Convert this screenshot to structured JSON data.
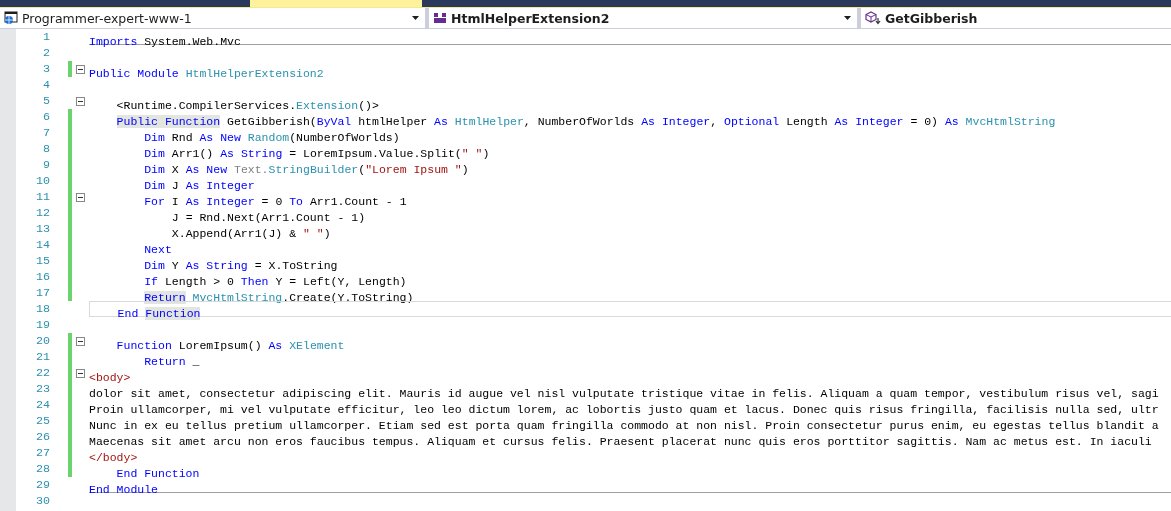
{
  "navigation_bar": [
    {
      "kind": "project",
      "label": "Programmer-expert-www-1"
    },
    {
      "kind": "class",
      "label": "HtmlHelperExtension2"
    },
    {
      "kind": "member",
      "label": "GetGibberish"
    }
  ],
  "editor": {
    "lines": [
      {
        "number": "1",
        "changed": false,
        "fold": false,
        "current": false,
        "separator_below": true,
        "tokens": [
          {
            "kind": "kw",
            "text": "Imports"
          },
          {
            "kind": "plain",
            "text": " System.Web.Mvc"
          }
        ]
      },
      {
        "number": "2",
        "changed": false,
        "fold": false,
        "current": false,
        "separator_below": false
      },
      {
        "number": "3",
        "changed": true,
        "fold": true,
        "current": false,
        "separator_below": false,
        "tokens": [
          {
            "kind": "kw",
            "text": "Public Module "
          },
          {
            "kind": "type",
            "text": "HtmlHelperExtension2"
          }
        ]
      },
      {
        "number": "4",
        "changed": false,
        "fold": false,
        "current": false,
        "separator_below": false
      },
      {
        "number": "5",
        "changed": false,
        "fold": true,
        "current": false,
        "separator_below": false,
        "tokens": [
          {
            "kind": "plain",
            "text": "    <Runtime.CompilerServices."
          },
          {
            "kind": "type",
            "text": "Extension"
          },
          {
            "kind": "plain",
            "text": "()>"
          }
        ]
      },
      {
        "number": "6",
        "changed": true,
        "fold": false,
        "current": false,
        "separator_below": false,
        "tokens": [
          {
            "kind": "ref",
            "text": "    Public Function"
          },
          {
            "kind": "plain",
            "text": " GetGibberish("
          },
          {
            "kind": "kw",
            "text": "ByVal"
          },
          {
            "kind": "plain",
            "text": " htmlHelper "
          },
          {
            "kind": "kw",
            "text": "As "
          },
          {
            "kind": "type",
            "text": "HtmlHelper"
          },
          {
            "kind": "plain",
            "text": ", NumberOfWorlds "
          },
          {
            "kind": "kw",
            "text": "As Integer"
          },
          {
            "kind": "plain",
            "text": ", "
          },
          {
            "kind": "kw",
            "text": "Optional"
          },
          {
            "kind": "plain",
            "text": " Length "
          },
          {
            "kind": "kw",
            "text": "As Integer"
          },
          {
            "kind": "plain",
            "text": " = 0) "
          },
          {
            "kind": "kw",
            "text": "As "
          },
          {
            "kind": "type",
            "text": "MvcHtmlString"
          }
        ]
      },
      {
        "number": "7",
        "changed": true,
        "fold": false,
        "current": false,
        "separator_below": false,
        "tokens": [
          {
            "kind": "kw",
            "text": "        Dim"
          },
          {
            "kind": "plain",
            "text": " Rnd "
          },
          {
            "kind": "kw",
            "text": "As New "
          },
          {
            "kind": "type",
            "text": "Random"
          },
          {
            "kind": "plain",
            "text": "(NumberOfWorlds)"
          }
        ]
      },
      {
        "number": "8",
        "changed": true,
        "fold": false,
        "current": false,
        "separator_below": false,
        "tokens": [
          {
            "kind": "kw",
            "text": "        Dim"
          },
          {
            "kind": "plain",
            "text": " Arr1() "
          },
          {
            "kind": "kw",
            "text": "As String"
          },
          {
            "kind": "plain",
            "text": " = LoremIpsum.Value.Split("
          },
          {
            "kind": "str",
            "text": "\" \""
          },
          {
            "kind": "plain",
            "text": ")"
          }
        ]
      },
      {
        "number": "9",
        "changed": true,
        "fold": false,
        "current": false,
        "separator_below": false,
        "tokens": [
          {
            "kind": "kw",
            "text": "        Dim"
          },
          {
            "kind": "plain",
            "text": " X "
          },
          {
            "kind": "kw",
            "text": "As New "
          },
          {
            "kind": "dim",
            "text": "Text."
          },
          {
            "kind": "type",
            "text": "StringBuilder"
          },
          {
            "kind": "plain",
            "text": "("
          },
          {
            "kind": "str",
            "text": "\"Lorem Ipsum \""
          },
          {
            "kind": "plain",
            "text": ")"
          }
        ]
      },
      {
        "number": "10",
        "changed": true,
        "fold": false,
        "current": false,
        "separator_below": false,
        "tokens": [
          {
            "kind": "kw",
            "text": "        Dim"
          },
          {
            "kind": "plain",
            "text": " J "
          },
          {
            "kind": "kw",
            "text": "As Integer"
          }
        ]
      },
      {
        "number": "11",
        "changed": true,
        "fold": true,
        "current": false,
        "separator_below": false,
        "tokens": [
          {
            "kind": "kw",
            "text": "        For"
          },
          {
            "kind": "plain",
            "text": " I "
          },
          {
            "kind": "kw",
            "text": "As Integer"
          },
          {
            "kind": "plain",
            "text": " = 0 "
          },
          {
            "kind": "kw",
            "text": "To"
          },
          {
            "kind": "plain",
            "text": " Arr1.Count - 1"
          }
        ]
      },
      {
        "number": "12",
        "changed": true,
        "fold": false,
        "current": false,
        "separator_below": false,
        "tokens": [
          {
            "kind": "plain",
            "text": "            J = Rnd.Next(Arr1.Count - 1)"
          }
        ]
      },
      {
        "number": "13",
        "changed": true,
        "fold": false,
        "current": false,
        "separator_below": false,
        "tokens": [
          {
            "kind": "plain",
            "text": "            X.Append(Arr1(J) & "
          },
          {
            "kind": "str",
            "text": "\" \""
          },
          {
            "kind": "plain",
            "text": ")"
          }
        ]
      },
      {
        "number": "14",
        "changed": true,
        "fold": false,
        "current": false,
        "separator_below": false,
        "tokens": [
          {
            "kind": "kw",
            "text": "        Next"
          }
        ]
      },
      {
        "number": "15",
        "changed": true,
        "fold": false,
        "current": false,
        "separator_below": false,
        "tokens": [
          {
            "kind": "kw",
            "text": "        Dim"
          },
          {
            "kind": "plain",
            "text": " Y "
          },
          {
            "kind": "kw",
            "text": "As String"
          },
          {
            "kind": "plain",
            "text": " = X.ToString"
          }
        ]
      },
      {
        "number": "16",
        "changed": true,
        "fold": false,
        "current": false,
        "separator_below": false,
        "tokens": [
          {
            "kind": "kw",
            "text": "        If"
          },
          {
            "kind": "plain",
            "text": " Length > 0 "
          },
          {
            "kind": "kw",
            "text": "Then"
          },
          {
            "kind": "plain",
            "text": " Y = Left(Y, Length)"
          }
        ]
      },
      {
        "number": "17",
        "changed": true,
        "fold": false,
        "current": false,
        "separator_below": false,
        "tokens": [
          {
            "kind": "ref",
            "text": "        Return"
          },
          {
            "kind": "type",
            "text": " MvcHtmlString"
          },
          {
            "kind": "plain",
            "text": ".Create(Y.ToString)"
          }
        ]
      },
      {
        "number": "18",
        "changed": false,
        "fold": false,
        "current": true,
        "separator_below": false,
        "tokens": [
          {
            "kind": "kw",
            "text": "    End "
          },
          {
            "kind": "ref",
            "text": "Function"
          }
        ]
      },
      {
        "number": "19",
        "changed": false,
        "fold": false,
        "current": false,
        "separator_below": false
      },
      {
        "number": "20",
        "changed": true,
        "fold": true,
        "current": false,
        "separator_below": false,
        "tokens": [
          {
            "kind": "kw",
            "text": "    Function"
          },
          {
            "kind": "plain",
            "text": " LoremIpsum() "
          },
          {
            "kind": "kw",
            "text": "As "
          },
          {
            "kind": "type",
            "text": "XElement"
          }
        ]
      },
      {
        "number": "21",
        "changed": true,
        "fold": false,
        "current": false,
        "separator_below": false,
        "tokens": [
          {
            "kind": "kw",
            "text": "        Return"
          },
          {
            "kind": "plain",
            "text": " _"
          }
        ]
      },
      {
        "number": "22",
        "changed": true,
        "fold": true,
        "current": false,
        "separator_below": false,
        "tokens": [
          {
            "kind": "xml",
            "text": "<body>"
          }
        ]
      },
      {
        "number": "23",
        "changed": true,
        "fold": false,
        "current": false,
        "separator_below": false,
        "tokens": [
          {
            "kind": "plain",
            "text": "dolor sit amet, consectetur adipiscing elit. Mauris id augue vel nisl vulputate tristique vitae in felis. Aliquam a quam tempor, vestibulum risus vel, sagi"
          }
        ]
      },
      {
        "number": "24",
        "changed": true,
        "fold": false,
        "current": false,
        "separator_below": false,
        "tokens": [
          {
            "kind": "plain",
            "text": "Proin ullamcorper, mi vel vulputate efficitur, leo leo dictum lorem, ac lobortis justo quam et lacus. Donec quis risus fringilla, facilisis nulla sed, ultr"
          }
        ]
      },
      {
        "number": "25",
        "changed": true,
        "fold": false,
        "current": false,
        "separator_below": false,
        "tokens": [
          {
            "kind": "plain",
            "text": "Nunc in ex eu tellus pretium ullamcorper. Etiam sed est porta quam fringilla commodo at non nisl. Proin consectetur purus enim, eu egestas tellus blandit a"
          }
        ]
      },
      {
        "number": "26",
        "changed": true,
        "fold": false,
        "current": false,
        "separator_below": false,
        "tokens": [
          {
            "kind": "plain",
            "text": "Maecenas sit amet arcu non eros faucibus tempus. Aliquam et cursus felis. Praesent placerat nunc quis eros porttitor sagittis. Nam ac metus est. In iaculi"
          }
        ]
      },
      {
        "number": "27",
        "changed": true,
        "fold": false,
        "current": false,
        "separator_below": false,
        "tokens": [
          {
            "kind": "xml",
            "text": "</body>"
          }
        ]
      },
      {
        "number": "28",
        "changed": true,
        "fold": false,
        "current": false,
        "separator_below": false,
        "tokens": [
          {
            "kind": "kw",
            "text": "    End Function"
          }
        ]
      },
      {
        "number": "29",
        "changed": false,
        "fold": false,
        "current": false,
        "separator_below": true,
        "tokens": [
          {
            "kind": "kw",
            "text": "End Module"
          }
        ]
      },
      {
        "number": "30",
        "changed": false,
        "fold": false,
        "current": false,
        "separator_below": false
      }
    ]
  }
}
